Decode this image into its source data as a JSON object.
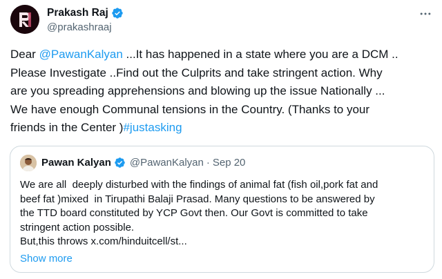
{
  "colors": {
    "accent": "#1d9bf0",
    "text": "#0f1419",
    "secondary": "#536471",
    "border": "#cfd9de"
  },
  "author": {
    "name": "Prakash Raj",
    "handle": "@prakashraaj",
    "avatar_icon": "pr-monogram-avatar",
    "verified_icon": "verified-badge-icon"
  },
  "more_icon": "more-options-icon",
  "tweet": {
    "lines": [
      {
        "pre": "Dear ",
        "mention": "@PawanKalyan",
        "post": " ...It has happened in a state where you are a DCM .."
      },
      {
        "text": "Please Investigate ..Find out the Culprits and take stringent action.  Why"
      },
      {
        "text": "are you spreading apprehensions and blowing up the issue Nationally ..."
      },
      {
        "text": "We have enough Communal tensions in the Country. (Thanks to your"
      },
      {
        "pre": "friends in the Center )",
        "hashtag": "#justasking"
      }
    ]
  },
  "quote": {
    "name": "Pawan Kalyan",
    "handle": "@PawanKalyan",
    "separator": "·",
    "date": "Sep 20",
    "lines": [
      "We are all  deeply disturbed with the findings of animal fat (fish oil,pork fat and",
      "beef fat )mixed  in Tirupathi Balaji Prasad. Many questions to be answered by",
      "the TTD board constituted by YCP Govt then. Our Govt is committed to take",
      "stringent action possible.",
      "But,this throws x.com/hinduitcell/st..."
    ],
    "show_more": "Show more"
  }
}
